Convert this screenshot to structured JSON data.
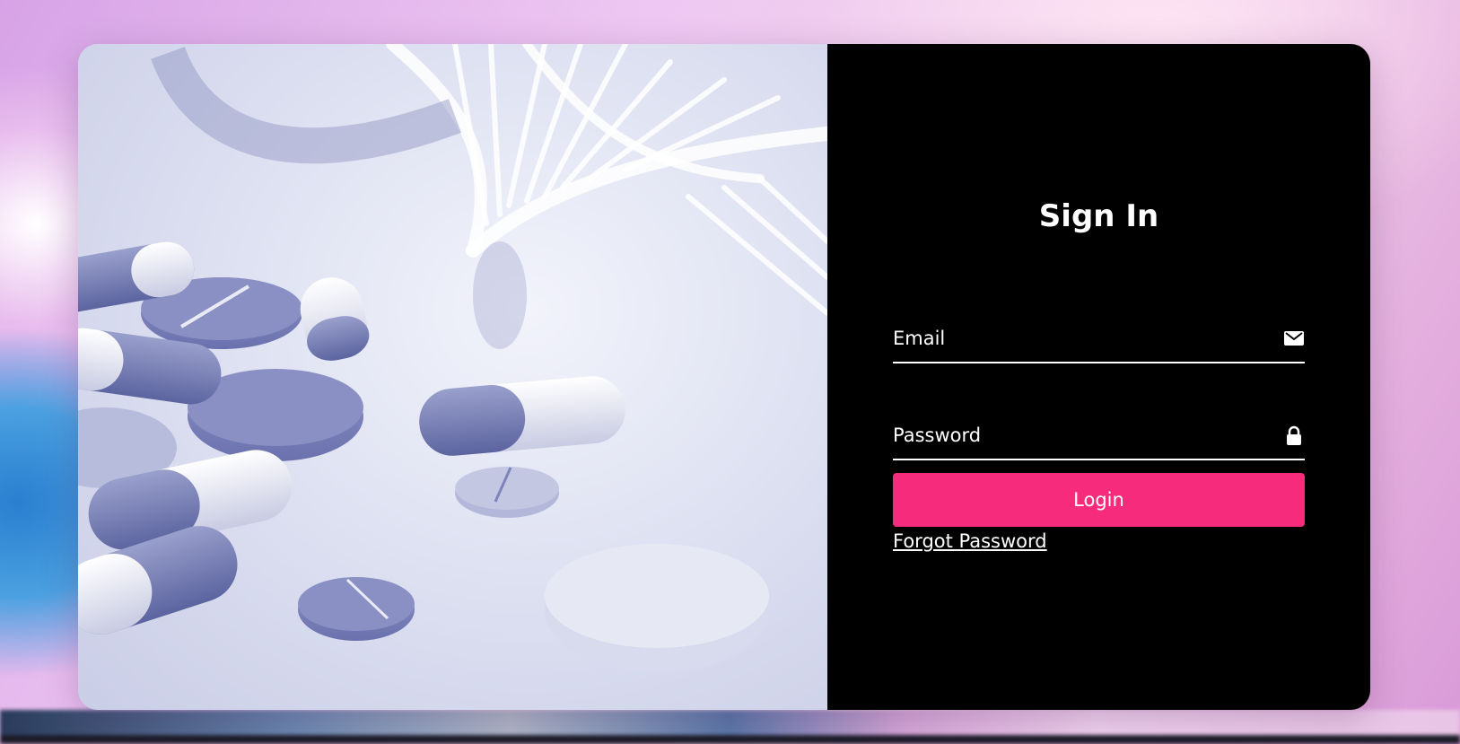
{
  "signin": {
    "title": "Sign In",
    "email_placeholder": "Email",
    "email_value": "",
    "password_placeholder": "Password",
    "password_value": "",
    "login_label": "Login",
    "forgot_label": "Forgot Password"
  },
  "icons": {
    "email": "envelope-icon",
    "password": "lock-icon"
  },
  "colors": {
    "accent": "#f72b7b",
    "panel_bg": "#000000",
    "text": "#ffffff"
  }
}
